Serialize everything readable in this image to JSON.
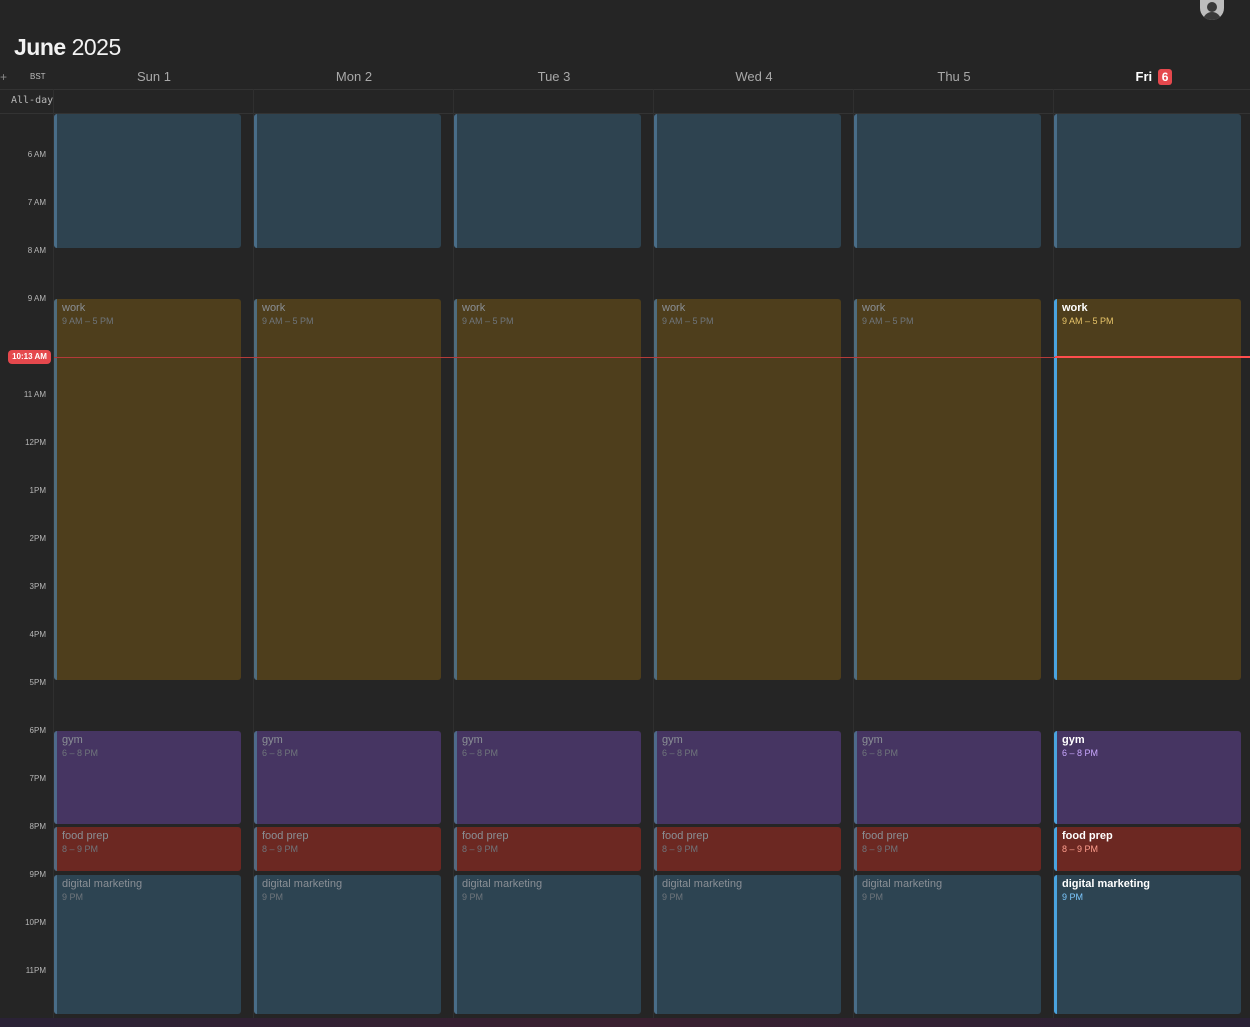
{
  "header": {
    "month": "June",
    "year": "2025",
    "timezone": "BST",
    "add_label": "+"
  },
  "allday_label": "All-day",
  "now_time": "10:13 AM",
  "days": [
    {
      "label": "Sun 1",
      "today": false
    },
    {
      "label": "Mon 2",
      "today": false
    },
    {
      "label": "Tue 3",
      "today": false
    },
    {
      "label": "Wed 4",
      "today": false
    },
    {
      "label": "Thu 5",
      "today": false
    },
    {
      "label": "Fri",
      "today": true,
      "badge": "6"
    }
  ],
  "hours": [
    "6 AM",
    "7 AM",
    "8 AM",
    "9 AM",
    "11 AM",
    "12PM",
    "1PM",
    "2PM",
    "3PM",
    "4PM",
    "5PM",
    "6PM",
    "7PM",
    "8PM",
    "9PM",
    "10PM",
    "11PM"
  ],
  "events": {
    "work": {
      "title": "work",
      "time": "9 AM – 5 PM"
    },
    "gym": {
      "title": "gym",
      "time": "6 – 8 PM"
    },
    "food_prep": {
      "title": "food prep",
      "time": "8 – 9 PM"
    },
    "digital_marketing": {
      "title": "digital marketing",
      "time": "9 PM"
    }
  },
  "colors": {
    "background": "#252525",
    "work": "#4e3e1c",
    "gym": "#463562",
    "food_prep": "#6c2822",
    "blue_block": "#2d4452",
    "today_accent": "#e5484d",
    "now_line": "#ff4d4d",
    "today_event_border": "#4aa3df"
  }
}
